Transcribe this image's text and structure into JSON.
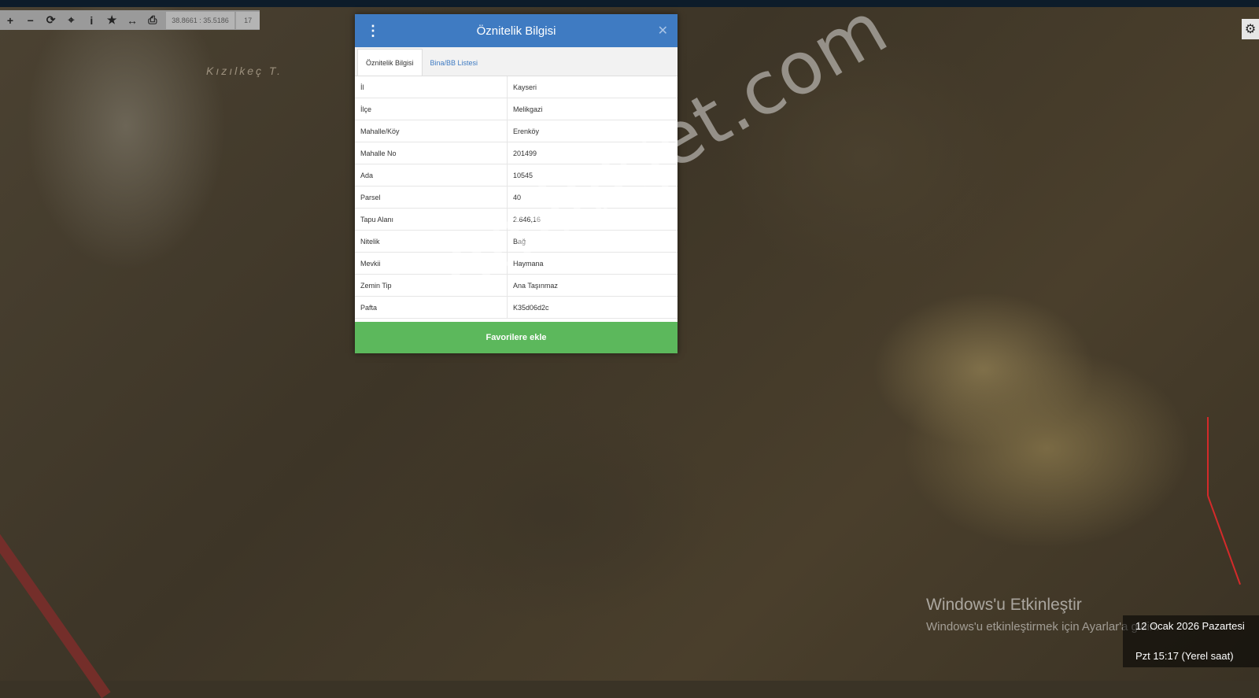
{
  "toolbar": {
    "icons": [
      "plus-icon",
      "minus-icon",
      "refresh-icon",
      "locate-icon",
      "info-icon",
      "star-icon",
      "measure-icon",
      "print-icon"
    ],
    "coordinates": "38.8661 : 35.5186",
    "zoom_level": "17"
  },
  "map": {
    "place_label": "Kızılkeç T."
  },
  "panel": {
    "title": "Öznitelik Bilgisi",
    "tabs": [
      {
        "label": "Öznitelik Bilgisi",
        "active": true
      },
      {
        "label": "Bina/BB Listesi",
        "active": false
      }
    ],
    "rows": [
      {
        "key": "İl",
        "value": "Kayseri"
      },
      {
        "key": "İlçe",
        "value": "Melikgazi"
      },
      {
        "key": "Mahalle/Köy",
        "value": "Erenköy"
      },
      {
        "key": "Mahalle No",
        "value": "201499"
      },
      {
        "key": "Ada",
        "value": "10545"
      },
      {
        "key": "Parsel",
        "value": "40"
      },
      {
        "key": "Tapu Alanı",
        "value": "2.646,16"
      },
      {
        "key": "Nitelik",
        "value": "Bağ"
      },
      {
        "key": "Mevkii",
        "value": "Haymana"
      },
      {
        "key": "Zemin Tip",
        "value": "Ana Taşınmaz"
      },
      {
        "key": "Pafta",
        "value": "K35d06d2c"
      }
    ],
    "favorite_button": "Favorilere ekle"
  },
  "watermark": "emlakjet.com",
  "windows": {
    "activate_title": "Windows'u Etkinleştir",
    "activate_sub": "Windows'u etkinleştirmek için Ayarlar'a gidin.",
    "date": "12 Ocak 2026 Pazartesi",
    "time": "Pzt 15:17 (Yerel saat)"
  },
  "colors": {
    "header_blue": "#3f7bc2",
    "button_green": "#5cb85c",
    "boundary_red": "#d42a2a"
  }
}
